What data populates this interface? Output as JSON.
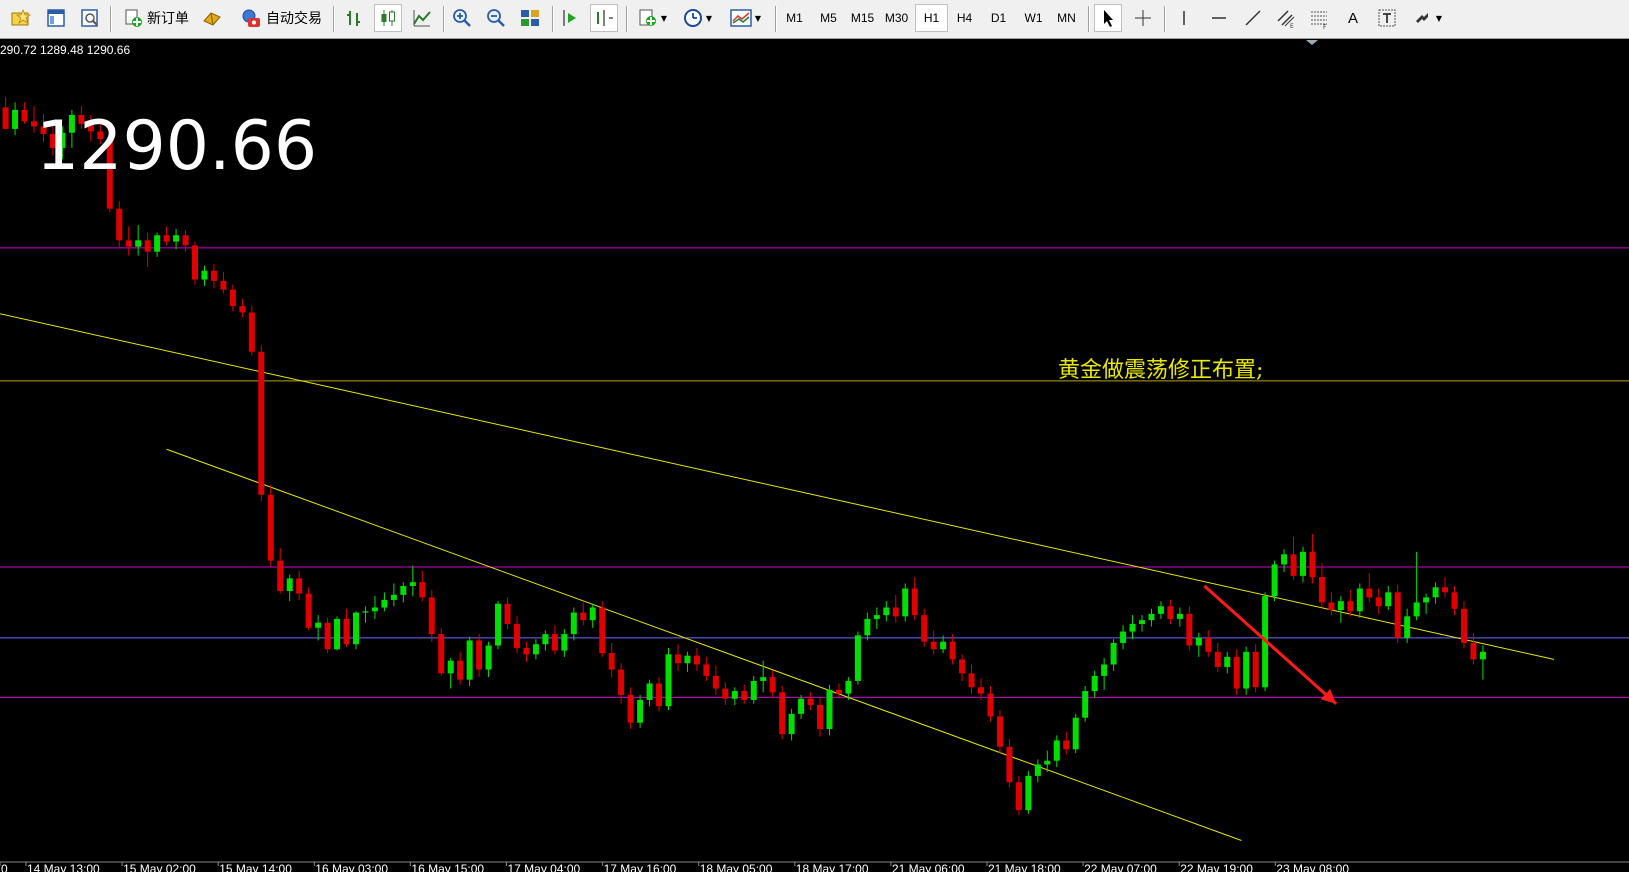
{
  "toolbar": {
    "new_order_label": "新订单",
    "auto_trading_label": "自动交易",
    "timeframes": [
      "M1",
      "M5",
      "M15",
      "M30",
      "H1",
      "H4",
      "D1",
      "W1",
      "MN"
    ],
    "selected_timeframe": "H1",
    "text_tool_label": "A"
  },
  "chart": {
    "ohlc_header": "290.72 1289.48 1290.66",
    "big_price": "1290.66",
    "annotation": "黄金做震荡修正布置;",
    "x_axis_labels": [
      "0",
      "14 May 13:00",
      "15 May 02:00",
      "15 May 14:00",
      "16 May 03:00",
      "16 May 15:00",
      "17 May 04:00",
      "17 May 16:00",
      "18 May 05:00",
      "18 May 17:00",
      "21 May 06:00",
      "21 May 18:00",
      "22 May 07:00",
      "22 May 19:00",
      "23 May 08:00"
    ],
    "colors": {
      "background": "#000000",
      "bull_candle": "#00e000",
      "bear_candle": "#e00000",
      "horizontal_magenta": "#cc00cc",
      "horizontal_gold": "#b8a000",
      "horizontal_blue": "#6a6aff",
      "trendline": "#e8e800",
      "arrow": "#ff1a1a",
      "annotation_text": "#e8e800",
      "axis_text": "#ffffff"
    }
  },
  "chart_data": {
    "type": "candlestick",
    "note_candles": [
      [
        0,
        1302.6,
        1303.4,
        1301.9,
        1300.9
      ],
      [
        1,
        1300.9,
        1303.0,
        1300.4,
        1302.4
      ],
      [
        2,
        1302.4,
        1303.0,
        1301.3,
        1301.5
      ],
      [
        3,
        1301.5,
        1302.7,
        1300.6,
        1301.1
      ],
      [
        4,
        1301.1,
        1302.1,
        1299.9,
        1300.5
      ],
      [
        5,
        1300.5,
        1301.5,
        1298.8,
        1299.4
      ],
      [
        6,
        1299.4,
        1301.1,
        1298.5,
        1300.6
      ],
      [
        7,
        1300.6,
        1302.4,
        1299.4,
        1302.0
      ],
      [
        8,
        1302.0,
        1302.7,
        1300.9,
        1301.3
      ],
      [
        9,
        1301.3,
        1302.0,
        1299.9,
        1300.7
      ],
      [
        10,
        1300.7,
        1301.4,
        1299.7,
        1300.1
      ],
      [
        11,
        1300.1,
        1300.6,
        1294.3,
        1294.6
      ],
      [
        12,
        1294.6,
        1295.2,
        1291.5,
        1292.1
      ],
      [
        13,
        1292.1,
        1293.2,
        1290.9,
        1291.6
      ],
      [
        14,
        1291.6,
        1293.3,
        1290.9,
        1292.1
      ],
      [
        15,
        1292.1,
        1292.7,
        1290.0,
        1291.2
      ],
      [
        16,
        1291.2,
        1292.7,
        1290.8,
        1292.5
      ],
      [
        17,
        1292.5,
        1293.2,
        1291.7,
        1292.0
      ],
      [
        18,
        1292.0,
        1293.0,
        1291.4,
        1292.5
      ],
      [
        19,
        1292.5,
        1292.9,
        1291.2,
        1291.7
      ],
      [
        20,
        1291.7,
        1292.0,
        1288.6,
        1289.0
      ],
      [
        21,
        1289.0,
        1290.1,
        1288.5,
        1289.7
      ],
      [
        22,
        1289.7,
        1290.2,
        1288.3,
        1288.9
      ],
      [
        23,
        1288.9,
        1289.6,
        1287.9,
        1288.2
      ],
      [
        24,
        1288.2,
        1288.6,
        1286.5,
        1286.9
      ],
      [
        25,
        1286.9,
        1287.5,
        1286.0,
        1286.4
      ],
      [
        26,
        1286.4,
        1286.9,
        1283.0,
        1283.3
      ],
      [
        27,
        1283.3,
        1283.8,
        1271.5,
        1272.0
      ],
      [
        28,
        1272.0,
        1272.8,
        1266.3,
        1266.8
      ],
      [
        29,
        1266.8,
        1267.8,
        1264.2,
        1264.4
      ],
      [
        30,
        1264.4,
        1265.7,
        1263.6,
        1265.4
      ],
      [
        31,
        1265.4,
        1266.0,
        1263.7,
        1264.2
      ],
      [
        32,
        1264.2,
        1264.7,
        1261.3,
        1261.5
      ],
      [
        33,
        1261.5,
        1262.5,
        1260.5,
        1261.9
      ],
      [
        34,
        1261.9,
        1262.3,
        1259.5,
        1259.8
      ],
      [
        35,
        1259.8,
        1262.4,
        1259.7,
        1262.2
      ],
      [
        36,
        1262.2,
        1263.0,
        1260.0,
        1260.2
      ],
      [
        37,
        1260.2,
        1262.8,
        1259.8,
        1262.7
      ],
      [
        38,
        1262.7,
        1263.2,
        1261.9,
        1262.8
      ],
      [
        39,
        1262.8,
        1264.0,
        1262.2,
        1263.1
      ],
      [
        40,
        1263.1,
        1264.3,
        1262.8,
        1263.7
      ],
      [
        41,
        1263.7,
        1265.0,
        1263.2,
        1264.1
      ],
      [
        42,
        1264.1,
        1265.1,
        1263.5,
        1264.8
      ],
      [
        43,
        1264.8,
        1266.4,
        1264.0,
        1265.1
      ],
      [
        44,
        1265.1,
        1266.0,
        1263.6,
        1263.9
      ],
      [
        45,
        1263.9,
        1264.5,
        1260.4,
        1261.0
      ],
      [
        46,
        1261.0,
        1261.5,
        1257.7,
        1257.9
      ],
      [
        47,
        1257.9,
        1259.1,
        1256.7,
        1258.9
      ],
      [
        48,
        1258.9,
        1259.6,
        1257.0,
        1257.4
      ],
      [
        49,
        1257.4,
        1260.8,
        1256.9,
        1260.5
      ],
      [
        50,
        1260.5,
        1261.0,
        1257.6,
        1258.2
      ],
      [
        51,
        1258.2,
        1260.4,
        1257.6,
        1260.1
      ],
      [
        52,
        1260.1,
        1263.6,
        1259.8,
        1263.4
      ],
      [
        53,
        1263.4,
        1263.9,
        1261.4,
        1261.8
      ],
      [
        54,
        1261.8,
        1262.4,
        1259.5,
        1259.9
      ],
      [
        55,
        1259.9,
        1260.4,
        1258.8,
        1259.4
      ],
      [
        56,
        1259.4,
        1260.6,
        1259.0,
        1260.2
      ],
      [
        57,
        1260.2,
        1261.3,
        1259.7,
        1261.0
      ],
      [
        58,
        1261.0,
        1261.7,
        1259.4,
        1259.7
      ],
      [
        59,
        1259.7,
        1261.4,
        1259.2,
        1261.0
      ],
      [
        60,
        1261.0,
        1263.1,
        1260.5,
        1262.7
      ],
      [
        61,
        1262.7,
        1263.5,
        1261.7,
        1262.1
      ],
      [
        62,
        1262.1,
        1263.4,
        1261.5,
        1263.1
      ],
      [
        63,
        1263.1,
        1263.6,
        1259.2,
        1259.5
      ],
      [
        64,
        1259.5,
        1260.3,
        1257.6,
        1258.2
      ],
      [
        65,
        1258.2,
        1258.7,
        1255.5,
        1256.2
      ],
      [
        66,
        1256.2,
        1256.8,
        1253.5,
        1254.0
      ],
      [
        67,
        1254.0,
        1256.2,
        1253.6,
        1255.8
      ],
      [
        68,
        1255.8,
        1257.4,
        1255.3,
        1257.1
      ],
      [
        69,
        1257.1,
        1257.6,
        1254.9,
        1255.3
      ],
      [
        70,
        1255.3,
        1259.9,
        1255.0,
        1259.4
      ],
      [
        71,
        1259.4,
        1260.2,
        1258.1,
        1258.7
      ],
      [
        72,
        1258.7,
        1259.6,
        1258.0,
        1259.3
      ],
      [
        73,
        1259.3,
        1259.9,
        1258.1,
        1258.6
      ],
      [
        74,
        1258.6,
        1259.2,
        1257.3,
        1257.7
      ],
      [
        75,
        1257.7,
        1258.5,
        1256.2,
        1256.7
      ],
      [
        76,
        1256.7,
        1257.2,
        1255.4,
        1255.9
      ],
      [
        77,
        1255.9,
        1256.8,
        1255.4,
        1256.5
      ],
      [
        78,
        1256.5,
        1257.0,
        1255.5,
        1255.8
      ],
      [
        79,
        1255.8,
        1257.7,
        1255.5,
        1257.3
      ],
      [
        80,
        1257.3,
        1258.9,
        1256.4,
        1257.6
      ],
      [
        81,
        1257.6,
        1258.1,
        1256.0,
        1256.4
      ],
      [
        82,
        1256.4,
        1256.9,
        1252.7,
        1253.1
      ],
      [
        83,
        1253.1,
        1255.1,
        1252.6,
        1254.7
      ],
      [
        84,
        1254.7,
        1256.2,
        1254.3,
        1255.9
      ],
      [
        85,
        1255.9,
        1256.4,
        1255.0,
        1255.4
      ],
      [
        86,
        1255.4,
        1256.0,
        1252.9,
        1253.5
      ],
      [
        87,
        1253.5,
        1257.0,
        1253.0,
        1256.6
      ],
      [
        88,
        1256.6,
        1257.1,
        1255.9,
        1256.3
      ],
      [
        89,
        1256.3,
        1257.6,
        1255.8,
        1257.3
      ],
      [
        90,
        1257.3,
        1261.2,
        1257.0,
        1260.9
      ],
      [
        91,
        1260.9,
        1262.7,
        1260.5,
        1262.2
      ],
      [
        92,
        1262.2,
        1263.1,
        1261.4,
        1262.5
      ],
      [
        93,
        1262.5,
        1263.6,
        1262.0,
        1263.1
      ],
      [
        94,
        1263.1,
        1264.1,
        1261.9,
        1262.4
      ],
      [
        95,
        1262.4,
        1265.0,
        1262.0,
        1264.6
      ],
      [
        96,
        1264.6,
        1265.5,
        1262.1,
        1262.5
      ],
      [
        97,
        1262.5,
        1263.0,
        1260.0,
        1260.4
      ],
      [
        98,
        1260.4,
        1261.3,
        1259.4,
        1259.8
      ],
      [
        99,
        1259.8,
        1260.9,
        1259.5,
        1260.4
      ],
      [
        100,
        1260.4,
        1261.0,
        1258.6,
        1259.0
      ],
      [
        101,
        1259.0,
        1259.4,
        1257.3,
        1257.9
      ],
      [
        102,
        1257.9,
        1258.6,
        1256.3,
        1256.8
      ],
      [
        103,
        1256.8,
        1257.5,
        1255.8,
        1256.3
      ],
      [
        104,
        1256.3,
        1256.9,
        1254.1,
        1254.5
      ],
      [
        105,
        1254.5,
        1255.0,
        1251.6,
        1252.1
      ],
      [
        106,
        1252.1,
        1252.7,
        1248.9,
        1249.3
      ],
      [
        107,
        1249.3,
        1249.8,
        1246.7,
        1247.1
      ],
      [
        108,
        1247.1,
        1250.2,
        1246.8,
        1249.8
      ],
      [
        109,
        1249.8,
        1251.1,
        1249.3,
        1250.7
      ],
      [
        110,
        1250.7,
        1251.8,
        1250.1,
        1251.0
      ],
      [
        111,
        1251.0,
        1253.0,
        1250.5,
        1252.6
      ],
      [
        112,
        1252.6,
        1253.3,
        1251.5,
        1251.9
      ],
      [
        113,
        1251.9,
        1254.7,
        1251.6,
        1254.4
      ],
      [
        114,
        1254.4,
        1256.9,
        1254.1,
        1256.5
      ],
      [
        115,
        1256.5,
        1258.1,
        1256.0,
        1257.7
      ],
      [
        116,
        1257.7,
        1259.1,
        1256.6,
        1258.6
      ],
      [
        117,
        1258.6,
        1260.6,
        1258.1,
        1260.3
      ],
      [
        118,
        1260.3,
        1261.7,
        1259.8,
        1261.2
      ],
      [
        119,
        1261.2,
        1262.5,
        1260.6,
        1261.8
      ],
      [
        120,
        1261.8,
        1262.5,
        1261.2,
        1262.1
      ],
      [
        121,
        1262.1,
        1263.0,
        1261.6,
        1262.6
      ],
      [
        122,
        1262.6,
        1263.6,
        1262.2,
        1263.2
      ],
      [
        123,
        1263.2,
        1263.7,
        1261.8,
        1262.2
      ],
      [
        124,
        1262.2,
        1263.1,
        1261.6,
        1262.6
      ],
      [
        125,
        1262.6,
        1263.2,
        1259.7,
        1260.1
      ],
      [
        126,
        1260.1,
        1261.1,
        1259.2,
        1260.7
      ],
      [
        127,
        1260.7,
        1261.3,
        1259.2,
        1259.6
      ],
      [
        128,
        1259.6,
        1260.3,
        1258.0,
        1258.4
      ],
      [
        129,
        1258.4,
        1259.6,
        1257.9,
        1259.2
      ],
      [
        130,
        1259.2,
        1259.8,
        1256.2,
        1256.7
      ],
      [
        131,
        1256.7,
        1260.0,
        1256.2,
        1259.6
      ],
      [
        132,
        1259.6,
        1260.2,
        1256.4,
        1256.8
      ],
      [
        133,
        1256.8,
        1264.3,
        1256.5,
        1264.0
      ],
      [
        134,
        1264.0,
        1266.8,
        1263.6,
        1266.5
      ],
      [
        135,
        1266.5,
        1267.7,
        1265.9,
        1267.3
      ],
      [
        136,
        1267.3,
        1268.7,
        1265.3,
        1265.6
      ],
      [
        137,
        1265.6,
        1267.9,
        1265.1,
        1267.5
      ],
      [
        138,
        1267.5,
        1268.9,
        1265.0,
        1265.5
      ],
      [
        139,
        1265.5,
        1266.6,
        1263.1,
        1263.5
      ],
      [
        140,
        1263.5,
        1264.3,
        1262.5,
        1262.9
      ],
      [
        141,
        1262.9,
        1264.0,
        1261.9,
        1263.6
      ],
      [
        142,
        1263.6,
        1264.5,
        1262.4,
        1262.8
      ],
      [
        143,
        1262.8,
        1265.0,
        1262.3,
        1264.6
      ],
      [
        144,
        1264.6,
        1265.8,
        1263.5,
        1263.9
      ],
      [
        145,
        1263.9,
        1264.6,
        1262.6,
        1263.2
      ],
      [
        146,
        1263.2,
        1264.8,
        1262.9,
        1264.3
      ],
      [
        147,
        1264.3,
        1264.9,
        1260.3,
        1260.7
      ],
      [
        148,
        1260.7,
        1263.0,
        1260.3,
        1262.4
      ],
      [
        149,
        1262.4,
        1267.5,
        1262.1,
        1263.5
      ],
      [
        150,
        1263.5,
        1264.2,
        1262.6,
        1263.9
      ],
      [
        151,
        1263.9,
        1265.1,
        1263.4,
        1264.7
      ],
      [
        152,
        1264.7,
        1265.5,
        1263.9,
        1264.3
      ],
      [
        153,
        1264.3,
        1264.8,
        1262.5,
        1263.0
      ],
      [
        154,
        1263.0,
        1263.6,
        1259.9,
        1260.3
      ],
      [
        155,
        1260.3,
        1261.1,
        1258.6,
        1259.0
      ],
      [
        156,
        1259.0,
        1260.1,
        1257.4,
        1259.6
      ]
    ],
    "candle_format": [
      "index",
      "open",
      "high",
      "low",
      "close"
    ],
    "price_range": [
      1243,
      1308
    ],
    "horizontal_levels": [
      {
        "price": 1291.5,
        "color": "magenta"
      },
      {
        "price": 1281.0,
        "color": "gold"
      },
      {
        "price": 1266.3,
        "color": "magenta"
      },
      {
        "price": 1260.7,
        "color": "blue"
      },
      {
        "price": 1256.0,
        "color": "magenta"
      }
    ],
    "trendlines": [
      {
        "from": [
          -1.2,
          1286.4
        ],
        "to": [
          163.5,
          1259.0
        ]
      },
      {
        "from": [
          17.0,
          1275.6
        ],
        "to": [
          130.5,
          1244.7
        ]
      }
    ],
    "arrow": {
      "from": [
        126.6,
        1264.8
      ],
      "to": [
        140.5,
        1255.5
      ]
    }
  }
}
